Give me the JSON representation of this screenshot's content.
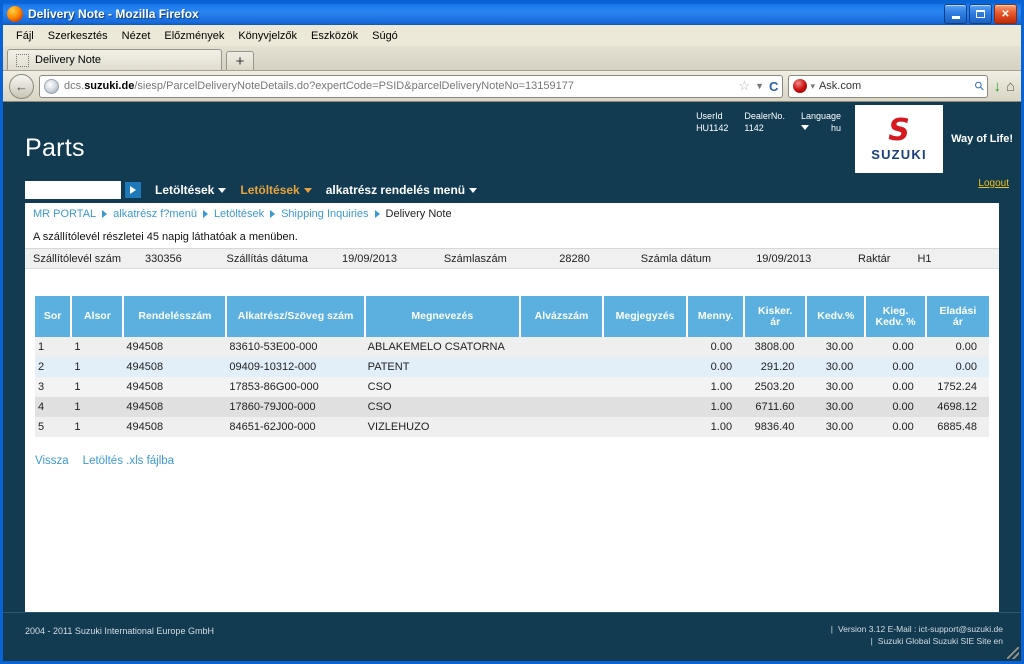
{
  "browser": {
    "title": "Delivery Note - Mozilla Firefox",
    "window_buttons": {
      "minimize": "_",
      "maximize": "□",
      "close": "✕"
    },
    "menus": [
      "Fájl",
      "Szerkesztés",
      "Nézet",
      "Előzmények",
      "Könyvjelzők",
      "Eszközök",
      "Súgó"
    ],
    "tab_title": "Delivery Note",
    "new_tab_label": "+",
    "url_prefix": "dcs.",
    "url_domain": "suzuki.de",
    "url_path": "/siesp/ParcelDeliveryNoteDetails.do?expertCode=PSID&parcelDeliveryNoteNo=13159177",
    "search_engine": "Ask.com",
    "back_glyph": "←",
    "reload_glyph": "C"
  },
  "header": {
    "site_title": "Parts",
    "user_id_label": "UserId",
    "user_id_value": "HU1142",
    "dealer_no_label": "DealerNo.",
    "dealer_no_value": "1142",
    "language_label": "Language",
    "language_value": "hu",
    "logo_mark": "S",
    "logo_word": "SUZUKI",
    "tagline": "Way of Life!",
    "logout_label": "Logout"
  },
  "navbar": {
    "search_value": "",
    "search_placeholder": "",
    "go_label": "▶",
    "menus": [
      {
        "label": "Letöltések",
        "highlight": false
      },
      {
        "label": "Letöltések",
        "highlight": true
      },
      {
        "label": "alkatrész rendelés menü",
        "highlight": false
      }
    ]
  },
  "breadcrumb": [
    {
      "label": "MR PORTAL",
      "current": false
    },
    {
      "label": "alkatrész f?menü",
      "current": false
    },
    {
      "label": "Letöltések",
      "current": false
    },
    {
      "label": "Shipping Inquiries",
      "current": false
    },
    {
      "label": "Delivery Note",
      "current": true
    }
  ],
  "notice": "A szállítólevél részletei 45 napig láthatóak a menüben.",
  "detail_row": {
    "delivery_note_label": "Szállítólevél szám",
    "delivery_note_value": "330356",
    "shipping_date_label": "Szállítás dátuma",
    "shipping_date_value": "19/09/2013",
    "invoice_no_label": "Számlaszám",
    "invoice_no_value": "28280",
    "invoice_date_label": "Számla dátum",
    "invoice_date_value": "19/09/2013",
    "warehouse_label": "Raktár",
    "warehouse_value": "H1"
  },
  "table": {
    "headers": [
      "Sor",
      "Alsor",
      "Rendelésszám",
      "Alkatrész/Szöveg szám",
      "Megnevezés",
      "Alvázszám",
      "Megjegyzés",
      "Menny.",
      "Kisker. ár",
      "Kedv.%",
      "Kieg. Kedv. %",
      "Eladási ár"
    ],
    "header_price_1_line1": "Kisker.",
    "header_price_1_line2": "ár",
    "header_disc2_line1": "Kieg.",
    "header_disc2_line2": "Kedv. %",
    "header_sale_line1": "Eladási",
    "header_sale_line2": "ár",
    "rows": [
      {
        "sor": "1",
        "alsor": "1",
        "rendelesszam": "494508",
        "alkatresz": "83610-53E00-000",
        "megnevezes": "ABLAKEMELO CSATORNA",
        "alvazszam": "",
        "megjegyzes": "",
        "menny": "0.00",
        "kisker": "3808.00",
        "kedv": "30.00",
        "kieg": "0.00",
        "eladasi": "0.00"
      },
      {
        "sor": "2",
        "alsor": "1",
        "rendelesszam": "494508",
        "alkatresz": "09409-10312-000",
        "megnevezes": "PATENT",
        "alvazszam": "",
        "megjegyzes": "",
        "menny": "0.00",
        "kisker": "291.20",
        "kedv": "30.00",
        "kieg": "0.00",
        "eladasi": "0.00"
      },
      {
        "sor": "3",
        "alsor": "1",
        "rendelesszam": "494508",
        "alkatresz": "17853-86G00-000",
        "megnevezes": "CSO",
        "alvazszam": "",
        "megjegyzes": "",
        "menny": "1.00",
        "kisker": "2503.20",
        "kedv": "30.00",
        "kieg": "0.00",
        "eladasi": "1752.24"
      },
      {
        "sor": "4",
        "alsor": "1",
        "rendelesszam": "494508",
        "alkatresz": "17860-79J00-000",
        "megnevezes": "CSO",
        "alvazszam": "",
        "megjegyzes": "",
        "menny": "1.00",
        "kisker": "6711.60",
        "kedv": "30.00",
        "kieg": "0.00",
        "eladasi": "4698.12"
      },
      {
        "sor": "5",
        "alsor": "1",
        "rendelesszam": "494508",
        "alkatresz": "84651-62J00-000",
        "megnevezes": "VIZLEHUZO",
        "alvazszam": "",
        "megjegyzes": "",
        "menny": "1.00",
        "kisker": "9836.40",
        "kedv": "30.00",
        "kieg": "0.00",
        "eladasi": "6885.48"
      }
    ]
  },
  "bottom_links": [
    {
      "label": "Vissza"
    },
    {
      "label": "Letöltés .xls fájlba"
    }
  ],
  "footer": {
    "copyright": "2004 - 2011 Suzuki International Europe GmbH",
    "line1": "Version 3.12 E-Mail : ict-support@suzuki.de",
    "line2": "Suzuki Global Suzuki SIE Site en",
    "pipe": "|"
  },
  "colors": {
    "brand_dark": "#123b52",
    "table_header_blue": "#5cb0e0",
    "link_blue": "#3c9ad1",
    "accent_gold": "#e8a33d",
    "suzuki_red": "#d61920",
    "logout_gold": "#f0c419"
  }
}
